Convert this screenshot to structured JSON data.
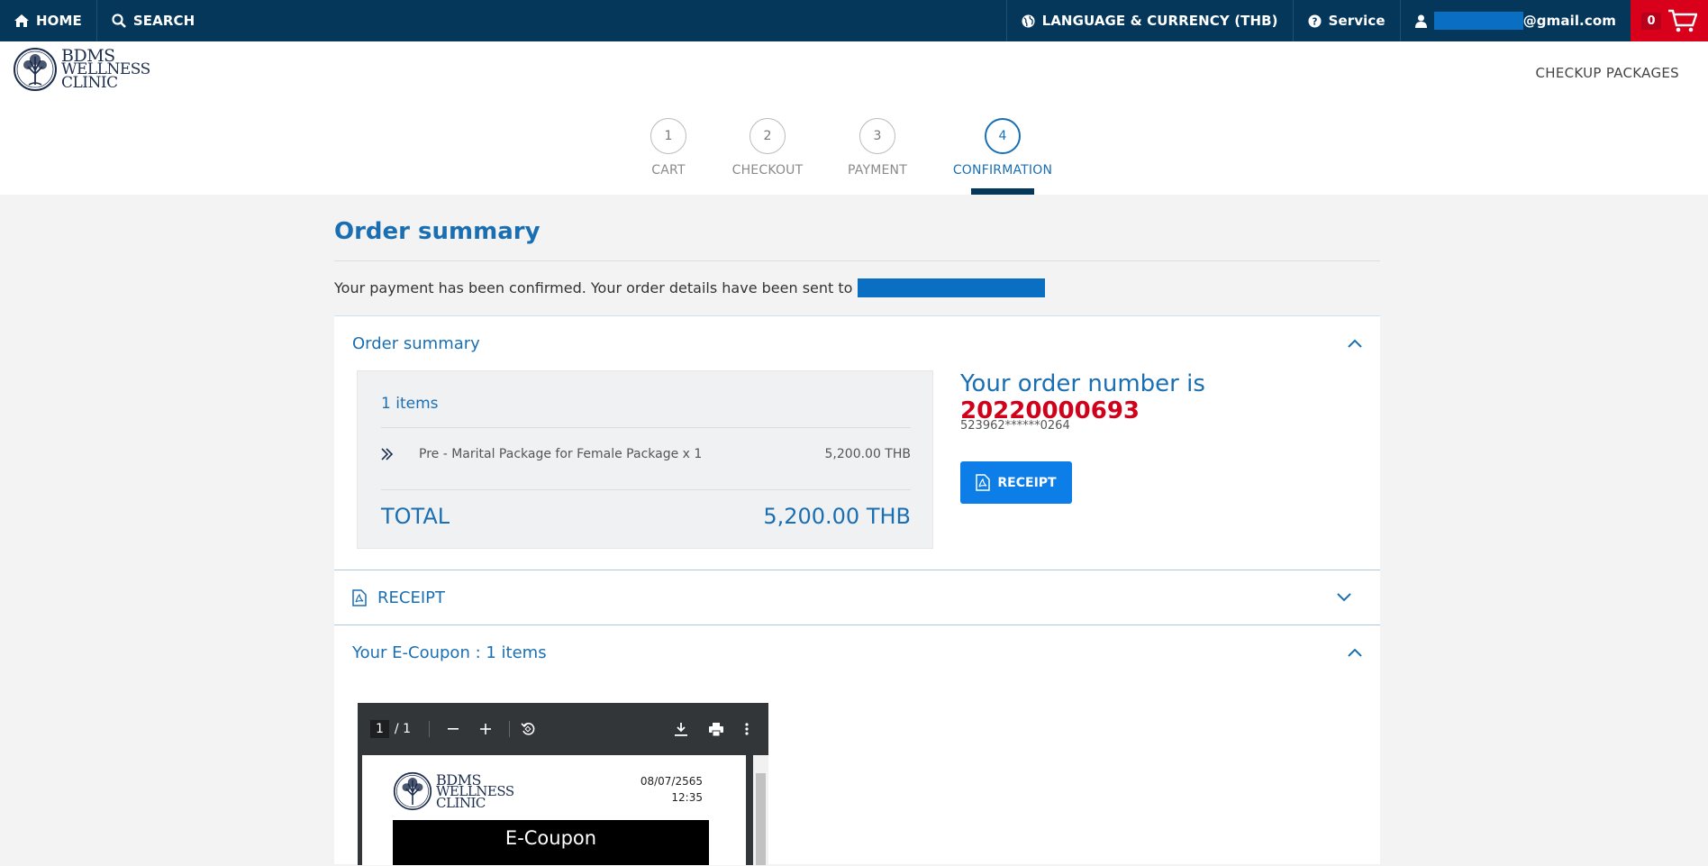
{
  "topbar": {
    "home": "HOME",
    "search": "SEARCH",
    "language": "LANGUAGE & CURRENCY (THB)",
    "service": "Service",
    "email_suffix": "@gmail.com",
    "cart_count": "0"
  },
  "header": {
    "logo": [
      "BDMS",
      "WELLNESS",
      "CLINIC"
    ],
    "nav_checkup": "CHECKUP PACKAGES"
  },
  "steps": [
    {
      "num": "1",
      "label": "CART"
    },
    {
      "num": "2",
      "label": "CHECKOUT"
    },
    {
      "num": "3",
      "label": "PAYMENT"
    },
    {
      "num": "4",
      "label": "CONFIRMATION"
    }
  ],
  "main": {
    "title": "Order summary",
    "confirm_message": "Your payment has been confirmed. Your order details have been sent to"
  },
  "order_panel": {
    "heading": "Order summary",
    "items_count": "1 items",
    "item_name": "Pre - Marital Package for Female Package x 1",
    "item_price": "5,200.00 THB",
    "total_label": "TOTAL",
    "total_value": "5,200.00 THB",
    "order_prefix": "Your order number is",
    "order_number": "20220000693",
    "card_masked": "523962******0264",
    "receipt_button": "RECEIPT"
  },
  "receipt_panel": {
    "heading": "RECEIPT"
  },
  "ecoupon_panel": {
    "heading": "Your E-Coupon : 1 items",
    "pdf_page": "1",
    "pdf_total": "/ 1",
    "sheet_date": "08/07/2565",
    "sheet_time": "12:35",
    "sheet_title": "E-Coupon"
  },
  "colors": {
    "topbar": "#05375b",
    "primary": "#1a6fb3",
    "order_number": "#d0021b",
    "cart": "#d9001b",
    "button": "#0d7ee8"
  }
}
